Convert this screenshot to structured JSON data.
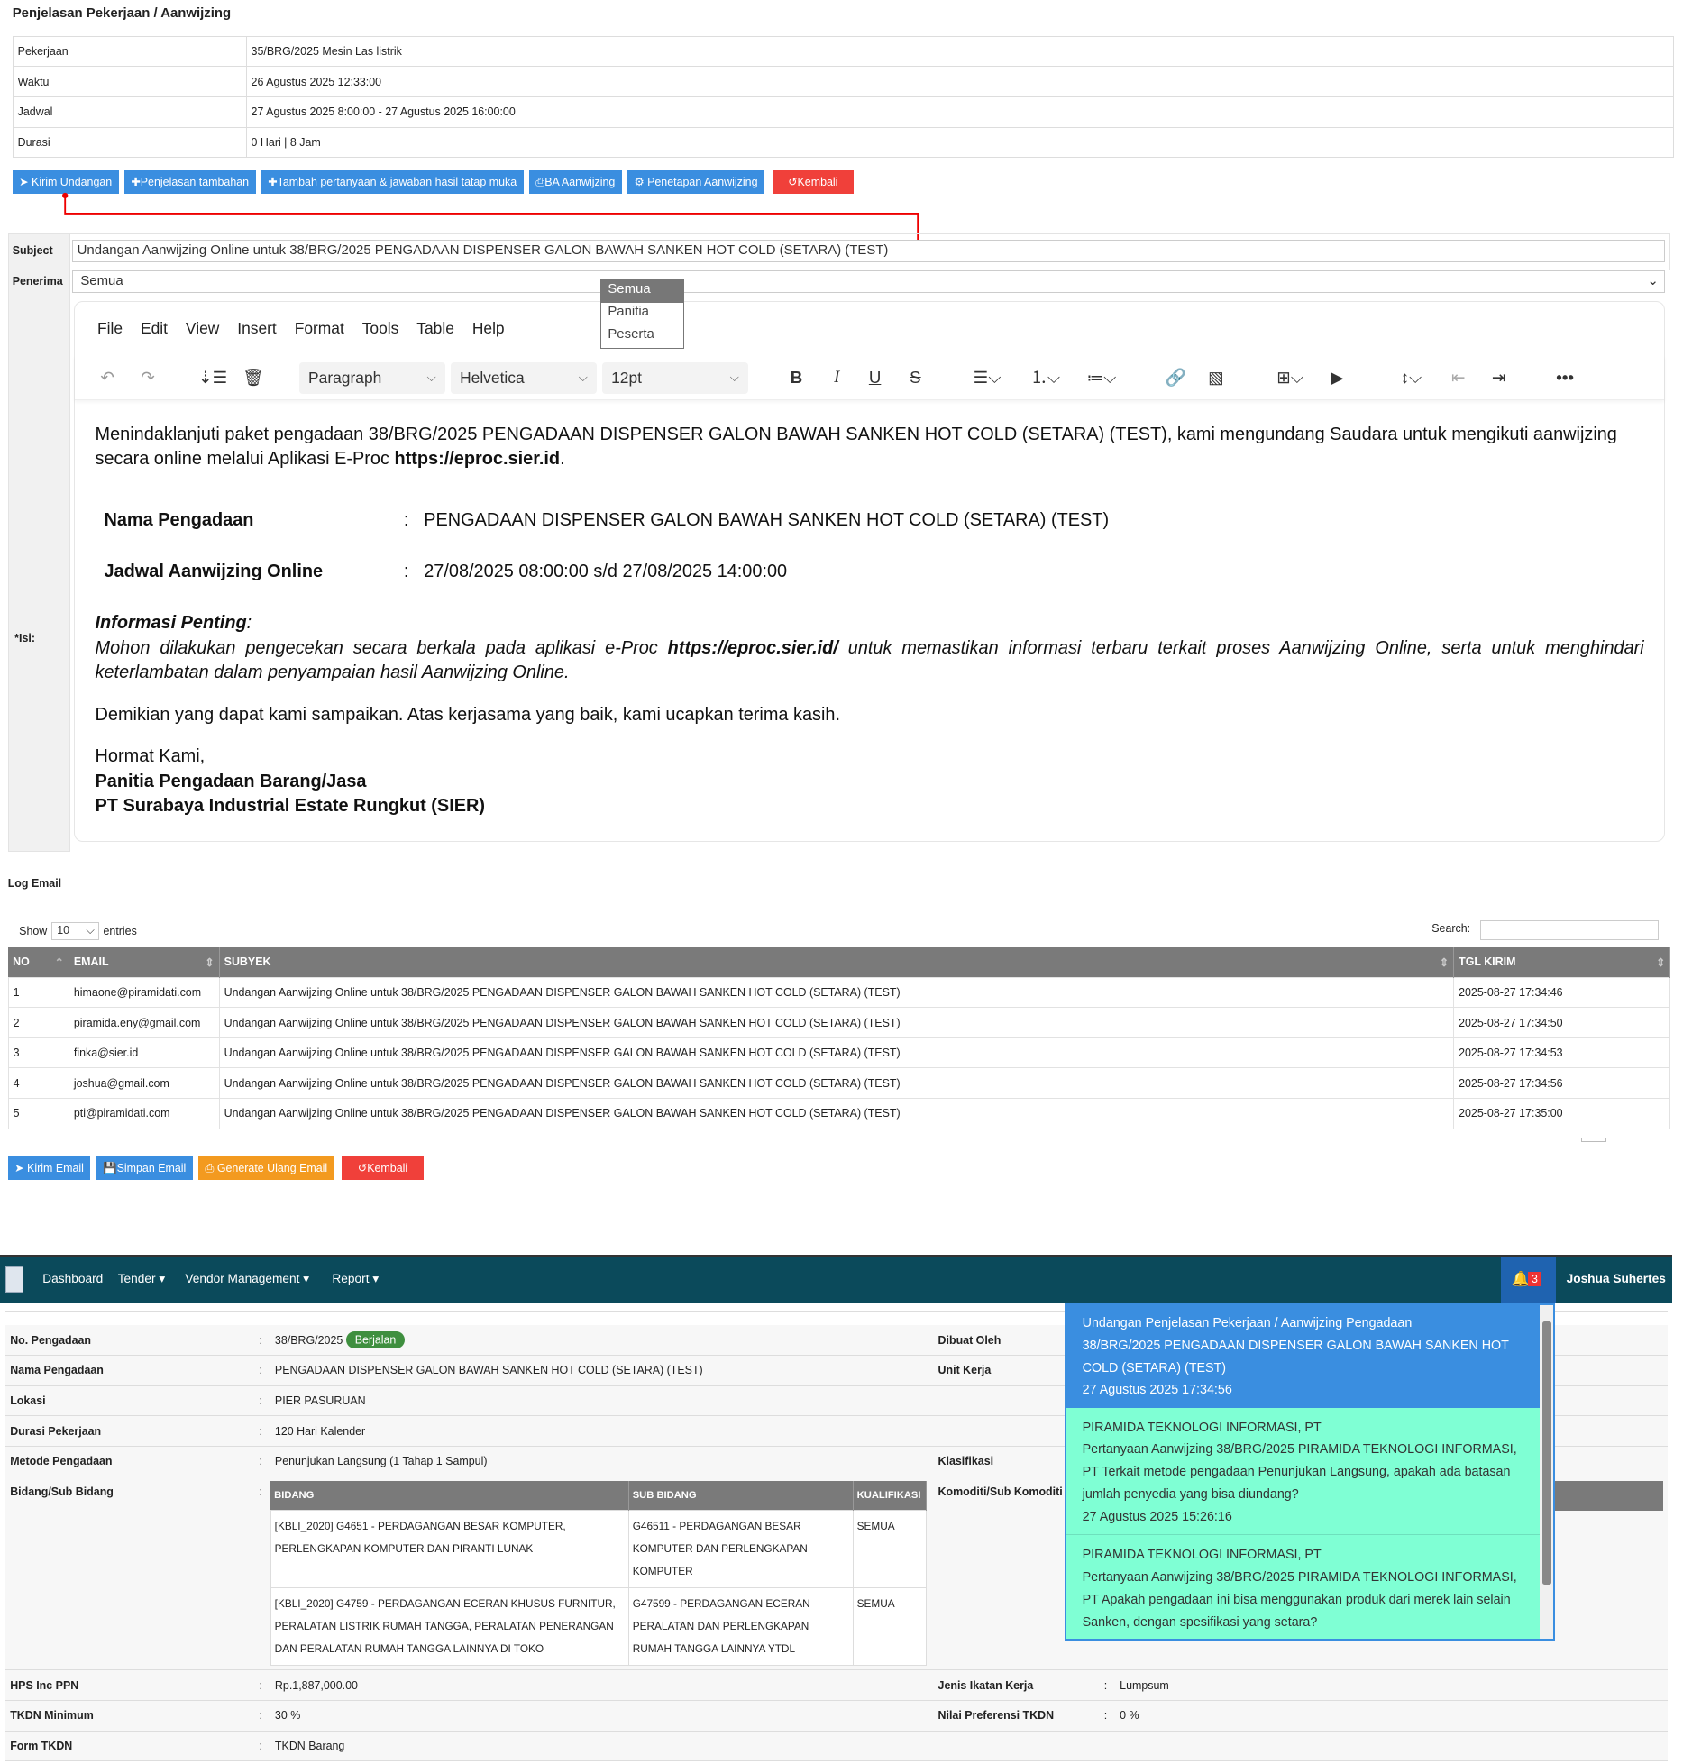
{
  "page_title": "Penjelasan Pekerjaan / Aanwijzing",
  "info": [
    {
      "label": "Pekerjaan",
      "value": "35/BRG/2025 Mesin Las listrik"
    },
    {
      "label": "Waktu",
      "value": "26 Agustus 2025 12:33:00"
    },
    {
      "label": "Jadwal",
      "value": "27 Agustus 2025 8:00:00 - 27 Agustus 2025 16:00:00"
    },
    {
      "label": "Durasi",
      "value": "0 Hari | 8 Jam"
    }
  ],
  "actions": {
    "kirim_undangan": "Kirim Undangan",
    "penjelasan_tambahan": "Penjelasan tambahan",
    "tambah_pertanyaan": "Tambah pertanyaan & jawaban hasil tatap muka",
    "ba_aanwijzing": "BA Aanwijzing",
    "penetapan": "Penetapan Aanwijzing",
    "kembali": "Kembali"
  },
  "form": {
    "subject_label": "Subject",
    "subject_value": "Undangan Aanwijzing Online untuk 38/BRG/2025  PENGADAAN DISPENSER GALON BAWAH SANKEN HOT  COLD (SETARA) (TEST)",
    "penerima_label": "Penerima",
    "penerima_value": "Semua",
    "penerima_options": [
      "Semua",
      "Panitia",
      "Peserta"
    ],
    "isi_label": "*Isi:"
  },
  "editor": {
    "menu": [
      "File",
      "Edit",
      "View",
      "Insert",
      "Format",
      "Tools",
      "Table",
      "Help"
    ],
    "block": "Paragraph",
    "font": "Helvetica",
    "size": "12pt",
    "p1a": "Menindaklanjuti paket pengadaan 38/BRG/2025 PENGADAAN DISPENSER GALON BAWAH SANKEN HOT COLD (SETARA) (TEST), kami mengundang Saudara untuk mengikuti aanwijzing secara online melalui Aplikasi E-Proc ",
    "p1link": "https://eproc.sier.id",
    "nama_label": "Nama Pengadaan",
    "nama_value": "PENGADAAN DISPENSER GALON BAWAH SANKEN HOT COLD (SETARA) (TEST)",
    "jadwal_label": "Jadwal Aanwijzing Online",
    "jadwal_value": "27/08/2025 08:00:00 s/d 27/08/2025 14:00:00",
    "colon": ":",
    "info_title": "Informasi Penting",
    "info_a": "Mohon dilakukan pengecekan secara berkala pada aplikasi e-Proc ",
    "info_link": "https://eproc.sier.id/",
    "info_b": " untuk memastikan informasi terbaru terkait proses Aanwijzing Online, serta untuk menghindari keterlambatan dalam penyampaian hasil Aanwijzing Online.",
    "closing": "Demikian yang dapat kami sampaikan. Atas kerjasama yang baik, kami ucapkan terima kasih.",
    "sign1": "Hormat Kami,",
    "sign2": "Panitia Pengadaan Barang/Jasa",
    "sign3": "PT Surabaya Industrial Estate Rungkut (SIER)"
  },
  "log": {
    "title": "Log Email",
    "show": "Show",
    "entries_value": "10",
    "entries": "entries",
    "search": "Search:",
    "headers": [
      "NO",
      "EMAIL",
      "SUBYEK",
      "TGL KIRIM"
    ],
    "rows": [
      [
        "1",
        "himaone@piramidati.com",
        "Undangan Aanwijzing Online untuk 38/BRG/2025 PENGADAAN DISPENSER GALON BAWAH SANKEN HOT COLD (SETARA) (TEST)",
        "2025-08-27 17:34:46"
      ],
      [
        "2",
        "piramida.eny@gmail.com",
        "Undangan Aanwijzing Online untuk 38/BRG/2025 PENGADAAN DISPENSER GALON BAWAH SANKEN HOT COLD (SETARA) (TEST)",
        "2025-08-27 17:34:50"
      ],
      [
        "3",
        "finka@sier.id",
        "Undangan Aanwijzing Online untuk 38/BRG/2025 PENGADAAN DISPENSER GALON BAWAH SANKEN HOT COLD (SETARA) (TEST)",
        "2025-08-27 17:34:53"
      ],
      [
        "4",
        "joshua@gmail.com",
        "Undangan Aanwijzing Online untuk 38/BRG/2025 PENGADAAN DISPENSER GALON BAWAH SANKEN HOT COLD (SETARA) (TEST)",
        "2025-08-27 17:34:56"
      ],
      [
        "5",
        "pti@piramidati.com",
        "Undangan Aanwijzing Online untuk 38/BRG/2025 PENGADAAN DISPENSER GALON BAWAH SANKEN HOT COLD (SETARA) (TEST)",
        "2025-08-27 17:35:00"
      ]
    ]
  },
  "bottom_actions": {
    "kirim_email": "Kirim Email",
    "simpan_email": "Simpan Email",
    "generate": "Generate Ulang Email",
    "kembali": "Kembali"
  },
  "nav": {
    "items": [
      "Dashboard",
      "Tender",
      "Vendor Management",
      "Report"
    ],
    "notif_count": "3",
    "user": "Joshua Suhertes"
  },
  "detail": {
    "no_label": "No. Pengadaan",
    "no_value": "38/BRG/2025",
    "status": "Berjalan",
    "nama_label": "Nama Pengadaan",
    "nama_value": "PENGADAAN DISPENSER GALON BAWAH SANKEN HOT COLD (SETARA) (TEST)",
    "lokasi_label": "Lokasi",
    "lokasi_value": "PIER PASURUAN",
    "durasi_label": "Durasi Pekerjaan",
    "durasi_value": "120 Hari Kalender",
    "metode_label": "Metode Pengadaan",
    "metode_value": "Penunjukan Langsung (1 Tahap 1 Sampul)",
    "bidang_label": "Bidang/Sub Bidang",
    "hps_label": "HPS Inc PPN",
    "hps_value": "Rp.1,887,000.00",
    "tkdn_label": "TKDN Minimum",
    "tkdn_value": "30 %",
    "form_label": "Form TKDN",
    "form_value": "TKDN Barang",
    "dibuat_label": "Dibuat Oleh",
    "unit_label": "Unit Kerja",
    "klas_label": "Klasifikasi",
    "komoditi_label": "Komoditi/Sub Komoditi",
    "jenis_label": "Jenis Ikatan Kerja",
    "jenis_value": "Lumpsum",
    "pref_label": "Nilai Preferensi TKDN",
    "pref_value": "0 %",
    "colon": ":",
    "sub_headers": [
      "BIDANG",
      "SUB BIDANG",
      "KUALIFIKASI"
    ],
    "sub_rows": [
      [
        "[KBLI_2020] G4651 - PERDAGANGAN BESAR KOMPUTER, PERLENGKAPAN KOMPUTER DAN PIRANTI LUNAK",
        "G46511 - PERDAGANGAN BESAR KOMPUTER DAN PERLENGKAPAN KOMPUTER",
        "SEMUA"
      ],
      [
        "[KBLI_2020] G4759 - PERDAGANGAN ECERAN KHUSUS FURNITUR, PERALATAN LISTRIK RUMAH TANGGA, PERALATAN PENERANGAN DAN PERALATAN RUMAH TANGGA LAINNYA DI TOKO",
        "G47599 - PERDAGANGAN ECERAN PERALATAN DAN PERLENGKAPAN RUMAH TANGGA LAINNYA YTDL",
        "SEMUA"
      ]
    ]
  },
  "notifications": [
    {
      "title": "Undangan Penjelasan Pekerjaan / Aanwijzing Pengadaan",
      "body": "38/BRG/2025 PENGADAAN DISPENSER GALON BAWAH SANKEN HOT COLD (SETARA) (TEST)",
      "time": "27 Agustus 2025 17:34:56"
    },
    {
      "title": "PIRAMIDA TEKNOLOGI INFORMASI, PT",
      "body": "Pertanyaan Aanwijzing 38/BRG/2025 PIRAMIDA TEKNOLOGI INFORMASI, PT Terkait metode pengadaan Penunjukan Langsung, apakah ada batasan jumlah penyedia yang bisa diundang?",
      "time": "27 Agustus 2025 15:26:16"
    },
    {
      "title": "PIRAMIDA TEKNOLOGI INFORMASI, PT",
      "body": "Pertanyaan Aanwijzing 38/BRG/2025 PIRAMIDA TEKNOLOGI INFORMASI, PT Apakah pengadaan ini bisa menggunakan produk dari merek lain selain Sanken, dengan spesifikasi yang setara?",
      "time": ""
    }
  ],
  "colors": {
    "primary": "#3a8ee0",
    "danger": "#f0403a",
    "warning": "#f39a1f",
    "nav": "#0b4a5b",
    "notif_new": "#3a8ee0",
    "notif": "#7fffd4",
    "badge": "#3f8f3f"
  }
}
